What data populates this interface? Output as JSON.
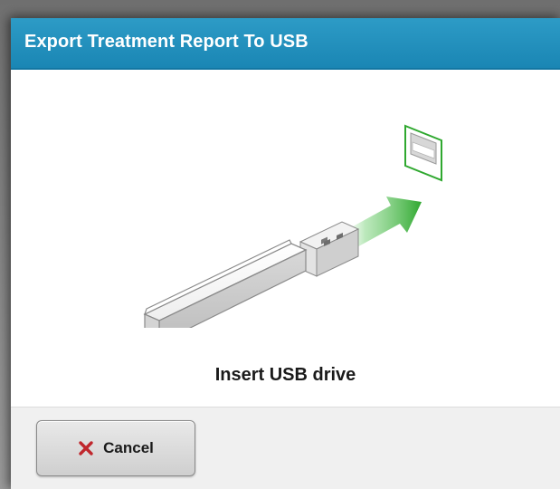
{
  "dialog": {
    "title": "Export Treatment Report To USB",
    "instruction": "Insert USB drive",
    "cancel_label": "Cancel"
  },
  "illustration": {
    "usb_drive_icon": "usb-drive",
    "arrow_icon": "insert-arrow",
    "port_icon": "usb-port",
    "arrow_color": "#3cb43c",
    "port_color": "#3cb43c"
  },
  "colors": {
    "title_bar": "#1f8cbc",
    "cancel_icon": "#c0272d",
    "footer": "#f0f0f0"
  }
}
